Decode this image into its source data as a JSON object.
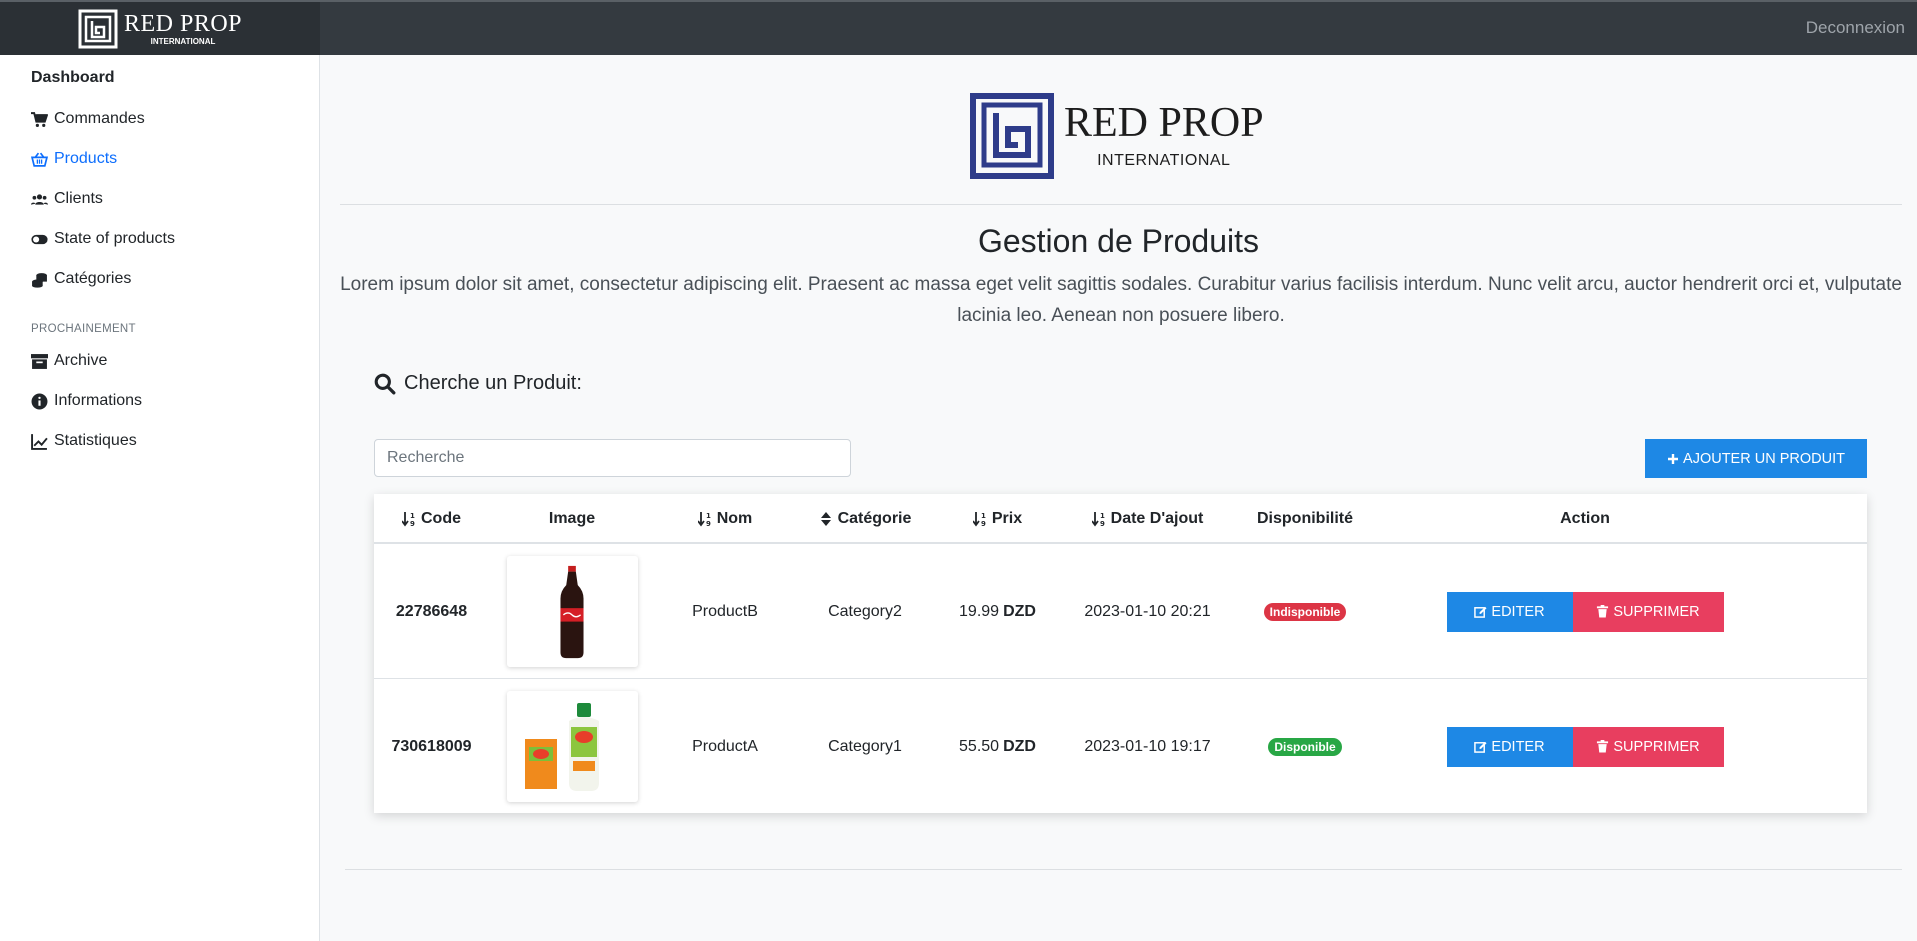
{
  "brand": {
    "name": "RED PROP",
    "sub": "INTERNATIONAL"
  },
  "header": {
    "logout_label": "Deconnexion"
  },
  "sidebar": {
    "title": "Dashboard",
    "items": [
      {
        "label": "Commandes",
        "icon": "cart-icon"
      },
      {
        "label": "Products",
        "icon": "basket-icon",
        "active": true
      },
      {
        "label": "Clients",
        "icon": "users-icon"
      },
      {
        "label": "State of products",
        "icon": "toggle-icon"
      },
      {
        "label": "Catégories",
        "icon": "coins-icon"
      }
    ],
    "section_label": "PROCHAINEMENT",
    "upcoming": [
      {
        "label": "Archive",
        "icon": "archive-icon"
      },
      {
        "label": "Informations",
        "icon": "info-icon"
      },
      {
        "label": "Statistiques",
        "icon": "chart-line-icon"
      }
    ]
  },
  "main": {
    "title": "Gestion de Produits",
    "lead": "Lorem ipsum dolor sit amet, consectetur adipiscing elit. Praesent ac massa eget velit sagittis sodales. Curabitur varius facilisis interdum. Nunc velit arcu, auctor hendrerit orci et, vulputate lacinia leo. Aenean non posuere libero.",
    "search_heading": "Cherche un Produit:",
    "search_placeholder": "Recherche",
    "add_button": "AJOUTER UN PRODUIT"
  },
  "table": {
    "headers": [
      "Code",
      "Image",
      "Nom",
      "Catégorie",
      "Prix",
      "Date D'ajout",
      "Disponibilité",
      "Action"
    ],
    "rows": [
      {
        "code": "22786648",
        "image": "cola-bottle",
        "nom": "ProductB",
        "categorie": "Category2",
        "prix": "19.99",
        "devise": "DZD",
        "date": "2023-01-10 20:21",
        "dispo": "Indisponible",
        "dispo_color": "#dc3545"
      },
      {
        "code": "730618009",
        "image": "off-repellent",
        "nom": "ProductA",
        "categorie": "Category1",
        "prix": "55.50",
        "devise": "DZD",
        "date": "2023-01-10 19:17",
        "dispo": "Disponible",
        "dispo_color": "#28a745"
      }
    ],
    "edit_label": "EDITER",
    "delete_label": "SUPPRIMER"
  },
  "colors": {
    "primary": "#1e88e5",
    "danger": "#e83e5f",
    "topbar": "#343a40",
    "active_link": "#0d6efd"
  }
}
